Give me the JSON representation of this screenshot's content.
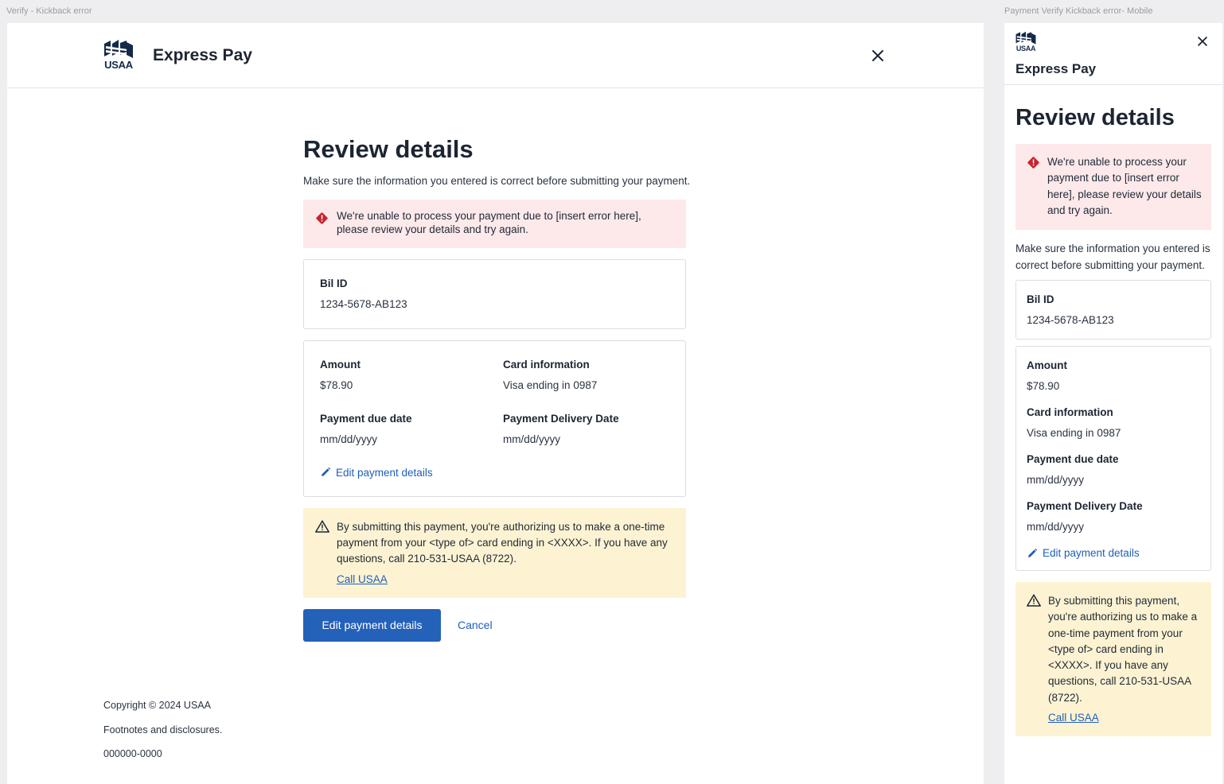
{
  "canvas": {
    "desktop_label": "Verify - Kickback error",
    "mobile_label": "Payment Verify Kickback error- Mobile"
  },
  "brand": {
    "logo_text": "USAA",
    "app_name": "Express Pay"
  },
  "review": {
    "title": "Review details",
    "subtitle": "Make sure the information you entered is correct before submitting your payment.",
    "error_message": "We're unable to process your payment due to [insert error here], please review your details and try again.",
    "bill": {
      "label": "Bil ID",
      "value": "1234-5678-AB123"
    },
    "amount": {
      "label": "Amount",
      "value": "$78.90"
    },
    "card": {
      "label": "Card information",
      "value": "Visa ending in 0987"
    },
    "due_date": {
      "label": "Payment due date",
      "value": "mm/dd/yyyy"
    },
    "delivery_date": {
      "label": "Payment Delivery Date",
      "value": "mm/dd/yyyy"
    },
    "edit_link": "Edit payment details",
    "authorization": "By submitting this payment, you're authorizing us to make a one-time payment from your <type of> card ending in <XXXX>. If you have any questions, call 210-531-USAA (8722).",
    "call_link": "Call USAA",
    "primary_button": "Edit payment details",
    "cancel_link": "Cancel"
  },
  "footer": {
    "copyright": "Copyright © 2024 USAA",
    "disclosures": "Footnotes and disclosures.",
    "code": "000000-0000"
  },
  "colors": {
    "error_bg": "#fde9ea",
    "error_icon": "#c8242f",
    "warning_bg": "#fdf3d2",
    "primary": "#2461b9",
    "link": "#1f5fb8",
    "brand_navy": "#12294a"
  },
  "icons": {
    "close": "close-icon",
    "error": "error-diamond-icon",
    "warning": "warning-triangle-icon",
    "edit": "pencil-icon",
    "logo": "usaa-eagle-logo"
  }
}
